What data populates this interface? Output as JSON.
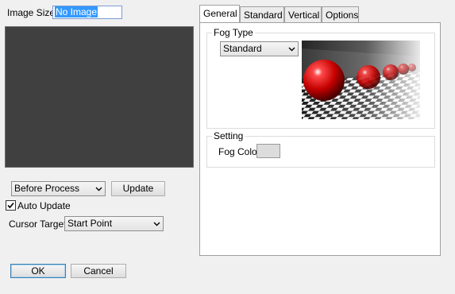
{
  "left": {
    "image_size_label": "Image Size",
    "image_size_value": "No Image",
    "process_select": "Before Process",
    "update_button": "Update",
    "auto_update_label": "Auto Update",
    "auto_update_checked": true,
    "cursor_target_label": "Cursor Target",
    "cursor_target_select": "Start Point"
  },
  "footer": {
    "ok_label": "OK",
    "cancel_label": "Cancel"
  },
  "tabs": [
    {
      "label": "General",
      "active": true
    },
    {
      "label": "Standard",
      "active": false
    },
    {
      "label": "Vertical",
      "active": false
    },
    {
      "label": "Options",
      "active": false
    }
  ],
  "general": {
    "fog_type_title": "Fog Type",
    "fog_type_select": "Standard",
    "setting_title": "Setting",
    "fog_color_label": "Fog Color",
    "fog_color_value": "#dcdcdc"
  }
}
